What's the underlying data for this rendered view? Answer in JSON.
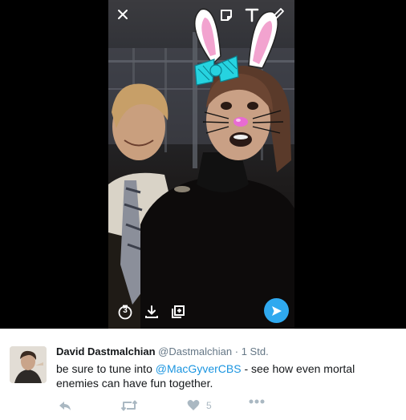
{
  "tweet": {
    "author_name": "David Dastmalchian",
    "handle": "@Dastmalchian",
    "separator": "·",
    "time": "1 Std.",
    "text_before": "be sure to tune into ",
    "mention": "@MacGyverCBS",
    "text_after": " - see how even mortal enemies can have fun together.",
    "like_count": "5"
  },
  "snap_toolbar": {
    "icons": [
      "close-icon",
      "sticker-icon",
      "text-icon",
      "pencil-icon"
    ]
  },
  "snap_bottom": {
    "timer_value": "3",
    "icons": [
      "timer-icon",
      "download-icon",
      "add-to-story-icon",
      "send-icon"
    ]
  },
  "colors": {
    "mention": "#1b95e0",
    "send_button": "#2fa9ef",
    "secondary_text": "#657786",
    "action_icons": "#aab8c2"
  }
}
